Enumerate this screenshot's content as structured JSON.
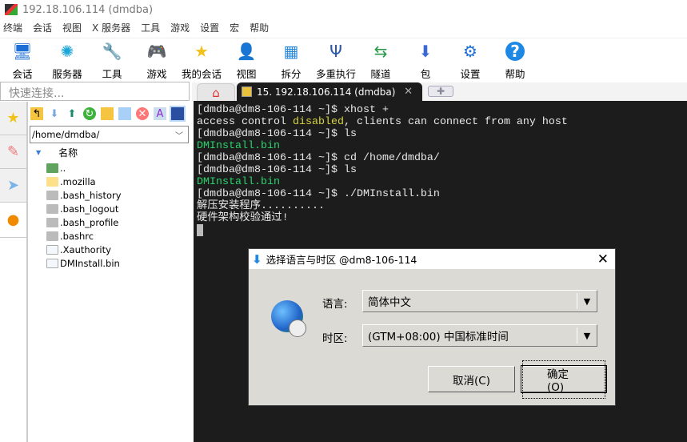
{
  "window": {
    "title": "192.18.106.114 (dmdba)"
  },
  "menu": [
    "终端",
    "会话",
    "视图",
    "X 服务器",
    "工具",
    "游戏",
    "设置",
    "宏",
    "帮助"
  ],
  "toolbar": [
    {
      "label": "会话",
      "icon": "session-icon",
      "glyph": "🖥"
    },
    {
      "label": "服务器",
      "icon": "servers-icon",
      "glyph": "✺"
    },
    {
      "label": "工具",
      "icon": "tools-icon",
      "glyph": "🔧"
    },
    {
      "label": "游戏",
      "icon": "games-icon",
      "glyph": "🎮"
    },
    {
      "label": "我的会话",
      "icon": "star-icon",
      "glyph": "★"
    },
    {
      "label": "视图",
      "icon": "view-icon",
      "glyph": "👤"
    },
    {
      "label": "拆分",
      "icon": "split-icon",
      "glyph": "▦"
    },
    {
      "label": "多重执行",
      "icon": "multiexec-icon",
      "glyph": "Ψ"
    },
    {
      "label": "隧道",
      "icon": "tunnel-icon",
      "glyph": "⇆"
    },
    {
      "label": "包",
      "icon": "packages-icon",
      "glyph": "⬇"
    },
    {
      "label": "设置",
      "icon": "settings-icon",
      "glyph": "⚙"
    },
    {
      "label": "帮助",
      "icon": "help-icon",
      "glyph": "?"
    }
  ],
  "quick_connect": {
    "placeholder": "快速连接..."
  },
  "tabs": {
    "active": "15. 192.18.106.114 (dmdba)"
  },
  "sftp": {
    "path": "/home/dmdba/",
    "column": "名称",
    "files": [
      {
        "name": "..",
        "type": "parent"
      },
      {
        "name": ".mozilla",
        "type": "folder"
      },
      {
        "name": ".bash_history",
        "type": "script"
      },
      {
        "name": ".bash_logout",
        "type": "script"
      },
      {
        "name": ".bash_profile",
        "type": "script"
      },
      {
        "name": ".bashrc",
        "type": "script"
      },
      {
        "name": ".Xauthority",
        "type": "file"
      },
      {
        "name": "DMInstall.bin",
        "type": "file"
      }
    ]
  },
  "terminal": {
    "lines": [
      {
        "parts": [
          {
            "t": "[dmdba@dm8-106-114 ~]$ xhost +"
          }
        ]
      },
      {
        "parts": [
          {
            "t": "access control "
          },
          {
            "t": "disabled",
            "c": "y"
          },
          {
            "t": ", clients can connect from any host"
          }
        ]
      },
      {
        "parts": [
          {
            "t": "[dmdba@dm8-106-114 ~]$ ls"
          }
        ]
      },
      {
        "parts": [
          {
            "t": "DMInstall.bin",
            "c": "g"
          }
        ]
      },
      {
        "parts": [
          {
            "t": "[dmdba@dm8-106-114 ~]$ cd /home/dmdba/"
          }
        ]
      },
      {
        "parts": [
          {
            "t": "[dmdba@dm8-106-114 ~]$ ls"
          }
        ]
      },
      {
        "parts": [
          {
            "t": "DMInstall.bin",
            "c": "g"
          }
        ]
      },
      {
        "parts": [
          {
            "t": "[dmdba@dm8-106-114 ~]$ ./DMInstall.bin"
          }
        ]
      },
      {
        "parts": [
          {
            "t": "解压安装程序.........."
          }
        ]
      },
      {
        "parts": [
          {
            "t": "硬件架构校验通过!"
          }
        ]
      }
    ]
  },
  "dialog": {
    "title": "选择语言与时区 @dm8-106-114",
    "language_label": "语言:",
    "language_value": "简体中文",
    "timezone_label": "时区:",
    "timezone_value": "(GTM+08:00) 中国标准时间",
    "cancel": "取消(C)",
    "ok": "确定(O)"
  }
}
